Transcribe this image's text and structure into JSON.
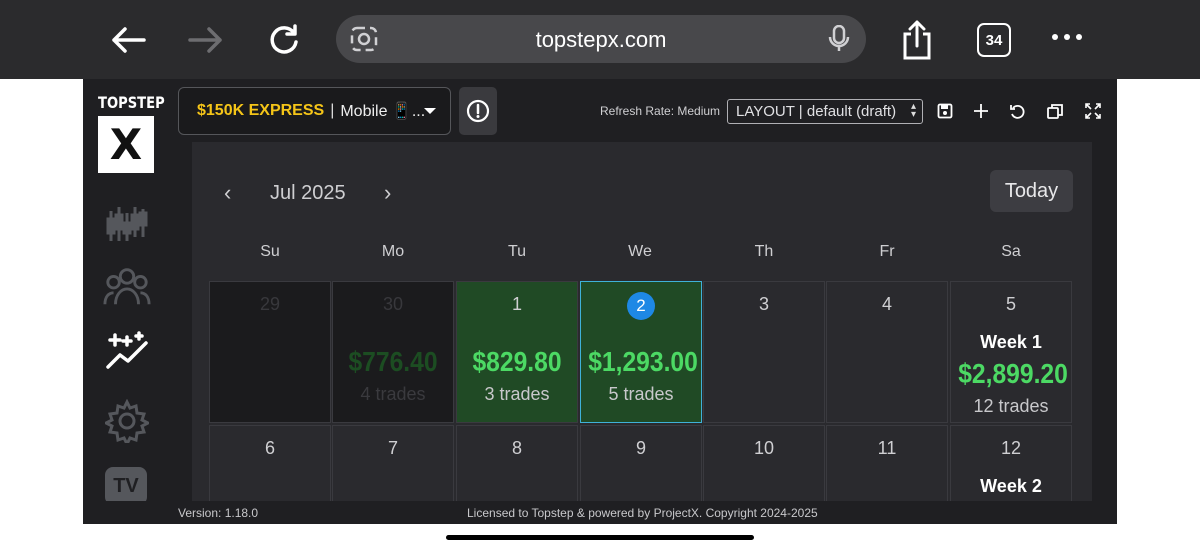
{
  "browser": {
    "url": "topstepx.com",
    "tab_count": "34"
  },
  "sidebar": {
    "logo_word": "TOPSTEP",
    "logo_letter": "X",
    "tv_label": "TV",
    "items": [
      {
        "name": "chart-icon"
      },
      {
        "name": "users-icon"
      },
      {
        "name": "sparkle-chart-icon"
      },
      {
        "name": "gear-icon"
      }
    ]
  },
  "toolbar": {
    "account_name": "$150K EXPRESS",
    "account_sep": "|",
    "account_mode": "Mobile 📱...",
    "refresh_rate": "Refresh Rate: Medium",
    "layout": "LAYOUT | default (draft)"
  },
  "calendar": {
    "month": "Jul 2025",
    "today_label": "Today",
    "days_of_week": [
      "Su",
      "Mo",
      "Tu",
      "We",
      "Th",
      "Fr",
      "Sa"
    ],
    "row1": {
      "su": {
        "date": "29"
      },
      "mo": {
        "date": "30",
        "pnl": "$776.40",
        "trades": "4 trades"
      },
      "tu": {
        "date": "1",
        "pnl": "$829.80",
        "trades": "3 trades"
      },
      "we": {
        "date": "2",
        "pnl": "$1,293.00",
        "trades": "5 trades"
      },
      "th": {
        "date": "3"
      },
      "fr": {
        "date": "4"
      },
      "sa": {
        "date": "5",
        "week": "Week 1",
        "pnl": "$2,899.20",
        "trades": "12 trades"
      }
    },
    "row2": {
      "su": {
        "date": "6"
      },
      "mo": {
        "date": "7"
      },
      "tu": {
        "date": "8"
      },
      "we": {
        "date": "9"
      },
      "th": {
        "date": "10"
      },
      "fr": {
        "date": "11"
      },
      "sa": {
        "date": "12",
        "week": "Week 2"
      }
    }
  },
  "footer": {
    "version": "Version: 1.18.0",
    "license": "Licensed to Topstep & powered by ProjectX. Copyright 2024-2025"
  },
  "colors": {
    "accent_gold": "#f5c518",
    "profit_green": "#4cd964",
    "today_blue": "#1e88e5"
  }
}
